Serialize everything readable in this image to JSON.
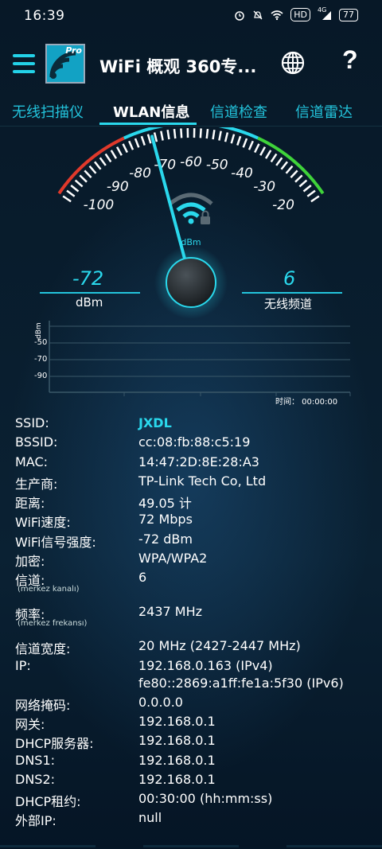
{
  "status_bar": {
    "time": "16:39",
    "icons": [
      "alarm-icon",
      "mute-icon",
      "wifi-icon",
      "hd-icon",
      "signal-icon",
      "battery-icon"
    ],
    "hd_label": "HD",
    "network_label": "4G",
    "battery_level": "77"
  },
  "app_bar": {
    "logo_badge": "Pro",
    "title": "WiFi 概观 360专..."
  },
  "tabs": [
    {
      "label": "无线扫描仪",
      "active": false
    },
    {
      "label": "WLAN信息",
      "active": true
    },
    {
      "label": "信道检查",
      "active": false
    },
    {
      "label": "信道雷达",
      "active": false
    }
  ],
  "gauge": {
    "scale_labels": [
      "-100",
      "-90",
      "-80",
      "-70",
      "-60",
      "-50",
      "-40",
      "-30",
      "-20"
    ],
    "unit_center": "dBm",
    "needle_value": -72,
    "left_readout": {
      "value": "-72",
      "label": "dBm"
    },
    "right_readout": {
      "value": "6",
      "label": "无线频道"
    }
  },
  "graph": {
    "y_axis_title": "dBm",
    "y_ticks": [
      "-50",
      "-70",
      "-90"
    ],
    "time_label": "时间：  00:00:00"
  },
  "info": {
    "ssid": {
      "key": "SSID:",
      "value": "JXDL"
    },
    "bssid": {
      "key": "BSSID:",
      "value": "cc:08:fb:88:c5:19"
    },
    "mac": {
      "key": "MAC:",
      "value": "14:47:2D:8E:28:A3"
    },
    "vendor": {
      "key": "生产商:",
      "value": "TP-Link Tech Co, Ltd"
    },
    "distance": {
      "key": "距离:",
      "value": "49.05 计"
    },
    "speed": {
      "key": "WiFi速度:",
      "value": "72 Mbps"
    },
    "signal": {
      "key": "WiFi信号强度:",
      "value": "-72 dBm"
    },
    "encryption": {
      "key": "加密:",
      "value": "WPA/WPA2"
    },
    "channel": {
      "key": "信道:",
      "sub": "(merkez kanalı)",
      "value": "6"
    },
    "frequency": {
      "key": "频率:",
      "sub": "(merkez frekansı)",
      "value": "2437 MHz"
    },
    "channel_width": {
      "key": "信道宽度:",
      "value": "20 MHz (2427-2447 MHz)"
    },
    "ip": {
      "key": "IP:",
      "value_v4": "192.168.0.163 (IPv4)",
      "value_v6": "fe80::2869:a1ff:fe1a:5f30 (IPv6)"
    },
    "netmask": {
      "key": "网络掩码:",
      "value": "0.0.0.0"
    },
    "gateway": {
      "key": "网关:",
      "value": "192.168.0.1"
    },
    "dhcp_server": {
      "key": "DHCP服务器:",
      "value": "192.168.0.1"
    },
    "dns1": {
      "key": "DNS1:",
      "value": "192.168.0.1"
    },
    "dns2": {
      "key": "DNS2:",
      "value": "192.168.0.1"
    },
    "dhcp_lease": {
      "key": "DHCP租约:",
      "value": "00:30:00 (hh:mm:ss)"
    },
    "external_ip": {
      "key": "外部IP:",
      "value": "null"
    }
  },
  "colors": {
    "accent": "#2ad8ec",
    "background": "#05121e",
    "gauge_red": "#e0392b",
    "gauge_green": "#3fd33a"
  }
}
